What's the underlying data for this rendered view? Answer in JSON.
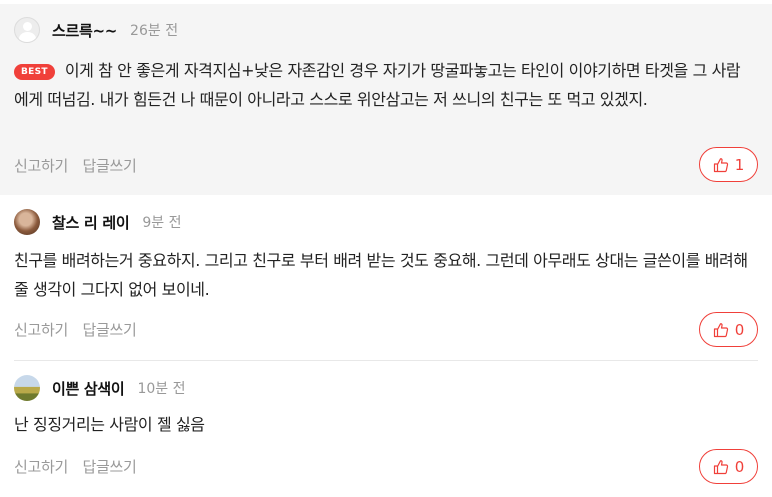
{
  "comments": [
    {
      "nickname": "스르륵~~",
      "time": "26분 전",
      "badge": "BEST",
      "text": "이게 참 안 좋은게 자격지심+낮은 자존감인 경우 자기가 땅굴파놓고는 타인이 이야기하면 타겟을 그 사람에게 떠넘김. 내가 힘든건 나 때문이 아니라고 스스로 위안삼고는 저 쓰니의 친구는 또 먹고 있겠지.",
      "report": "신고하기",
      "reply": "답글쓰기",
      "likes": "1"
    },
    {
      "nickname": "찰스 리 레이",
      "time": "9분 전",
      "text": " 친구를 배려하는거 중요하지. 그리고 친구로 부터 배려 받는 것도 중요해. 그런데 아무래도 상대는 글쓴이를 배려해 줄 생각이 그다지 없어 보이네.",
      "report": "신고하기",
      "reply": "답글쓰기",
      "likes": "0"
    },
    {
      "nickname": "이쁜 삼색이",
      "time": "10분 전",
      "text": " 난 징징거리는 사람이 젤 싫음",
      "report": "신고하기",
      "reply": "답글쓰기",
      "likes": "0"
    }
  ],
  "icons": {
    "avatar": "default-avatar-icon",
    "like": "thumbs-up-icon"
  },
  "colors": {
    "accent": "#f0403a",
    "best_bg": "#f5f5f5",
    "meta": "#999999"
  }
}
